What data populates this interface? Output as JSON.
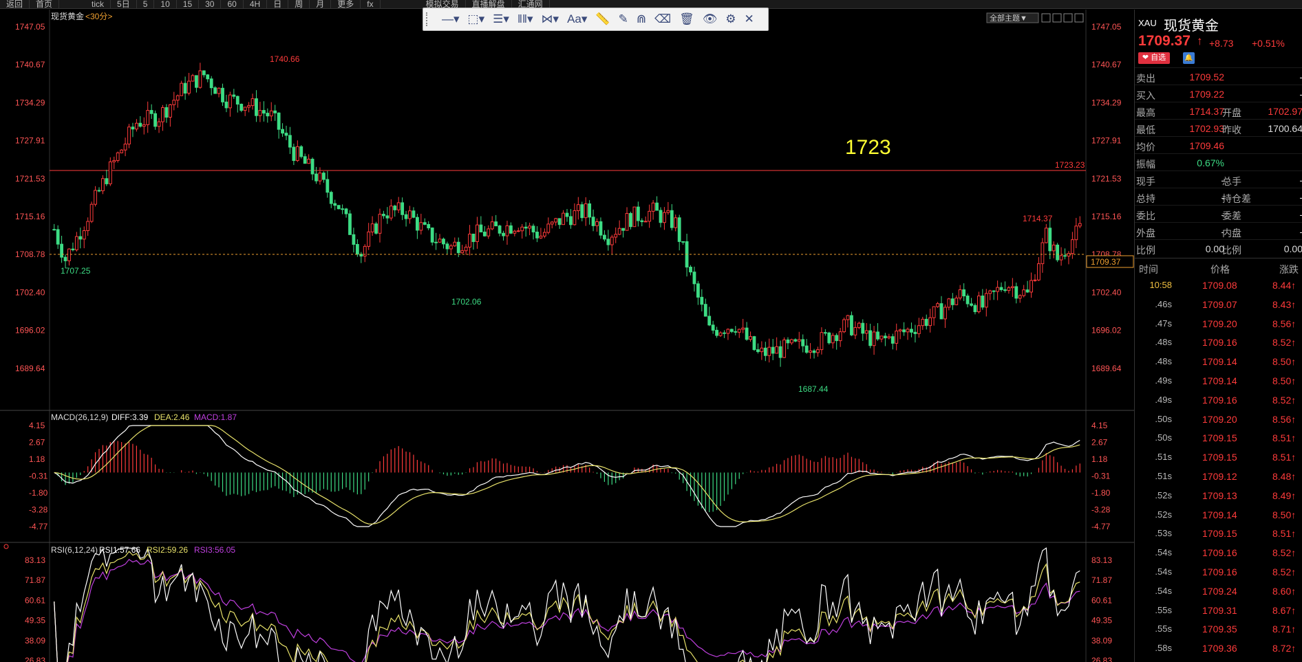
{
  "topbar": {
    "items": [
      "返回",
      "首页",
      "",
      "",
      "tick",
      "5日",
      "5",
      "10",
      "15",
      "30",
      "60",
      "4H",
      "日",
      "周",
      "月",
      "更多",
      "fx",
      "",
      "",
      "",
      "模拟交易",
      "直播解盘",
      "汇通网"
    ]
  },
  "chart": {
    "symbol_label": "现货黄金",
    "period_label": "<30分>",
    "theme_button": "全部主题▼",
    "annotation_text": "1723",
    "hline_label": "1723.23",
    "current_price_label": "1709.37",
    "price_ticks": [
      "1747.05",
      "1740.67",
      "1734.29",
      "1727.91",
      "1721.53",
      "1715.16",
      "1708.78",
      "1702.40",
      "1696.02",
      "1689.64"
    ],
    "marks": {
      "high": "1740.66",
      "low1": "1707.25",
      "low2": "1702.06",
      "low3": "1687.44",
      "high2": "1714.37"
    },
    "macd": {
      "label": "MACD(26,12,9)",
      "diff": "DIFF:3.39",
      "dea": "DEA:2.46",
      "macd": "MACD:1.87",
      "ticks": [
        "4.15",
        "2.67",
        "1.18",
        "-0.31",
        "-1.80",
        "-3.28",
        "-4.77"
      ]
    },
    "rsi": {
      "label": "RSI(6,12,24)",
      "rsi1": "RSI1:57.66",
      "rsi2": "RSI2:59.26",
      "rsi3": "RSI3:56.05",
      "ticks": [
        "83.13",
        "71.87",
        "60.61",
        "49.35",
        "38.09",
        "26.83"
      ]
    },
    "colors": {
      "up": "#ff3b3b",
      "down": "#3ddc84",
      "hline": "#ff3b3b",
      "annotation": "#ffff33",
      "diff": "#ffffff",
      "dea": "#e8e26a",
      "rsi1": "#ffffff",
      "rsi2": "#e8e26a",
      "rsi3": "#c040e0"
    }
  },
  "toolbar": {
    "tools": [
      {
        "icon": "line-tool-icon",
        "glyph": "—▾"
      },
      {
        "icon": "shape-tool-icon",
        "glyph": "⬚▾"
      },
      {
        "icon": "fib-tool-icon",
        "glyph": "☰▾"
      },
      {
        "icon": "channel-tool-icon",
        "glyph": "‖‖▾"
      },
      {
        "icon": "pattern-tool-icon",
        "glyph": "⋈▾"
      },
      {
        "icon": "text-tool-icon",
        "glyph": "Aa▾"
      },
      {
        "icon": "ruler-icon",
        "glyph": "📏"
      },
      {
        "icon": "pen-icon",
        "glyph": "✎"
      },
      {
        "icon": "magnet-icon",
        "glyph": "⋒"
      },
      {
        "icon": "eraser-icon",
        "glyph": "⌫"
      },
      {
        "icon": "trash-icon",
        "glyph": "🗑"
      },
      {
        "icon": "eye-icon",
        "glyph": "👁"
      },
      {
        "icon": "gear-icon",
        "glyph": "⚙"
      },
      {
        "icon": "close-icon",
        "glyph": "✕"
      }
    ]
  },
  "quote": {
    "code": "XAU",
    "name": "现货黄金",
    "price": "1709.37",
    "arrow": "↑",
    "change": "+8.73",
    "pct": "+0.51%",
    "fav_label": "❤ 自选",
    "bell_label": "🔔",
    "rows": [
      {
        "l": "卖出",
        "v": "1709.52",
        "l2": "",
        "v2": "-"
      },
      {
        "l": "买入",
        "v": "1709.22",
        "l2": "",
        "v2": "-"
      },
      {
        "l": "最高",
        "v": "1714.37",
        "l2": "开盘",
        "v2": "1702.97"
      },
      {
        "l": "最低",
        "v": "1702.93",
        "l2": "昨收",
        "v2": "1700.64"
      },
      {
        "l": "均价",
        "v": "1709.46",
        "l2": "",
        "v2": ""
      },
      {
        "l": "振幅",
        "v": "0.67%",
        "l2": "",
        "v2": ""
      },
      {
        "l": "现手",
        "v": "-",
        "l2": "总手",
        "v2": "-"
      },
      {
        "l": "总持",
        "v": "-",
        "l2": "持仓差",
        "v2": "-"
      },
      {
        "l": "委比",
        "v": "-",
        "l2": "委差",
        "v2": "-"
      },
      {
        "l": "外盘",
        "v": "-",
        "l2": "内盘",
        "v2": "-"
      },
      {
        "l": "比例",
        "v": "0.00",
        "l2": "比例",
        "v2": "0.00"
      }
    ]
  },
  "ticks": {
    "headers": [
      "时间",
      "价格",
      "涨跌"
    ],
    "rows": [
      {
        "t": "10:58",
        "p": "1709.08",
        "d": "8.44↑"
      },
      {
        "t": ".46s",
        "p": "1709.07",
        "d": "8.43↑"
      },
      {
        "t": ".47s",
        "p": "1709.20",
        "d": "8.56↑"
      },
      {
        "t": ".48s",
        "p": "1709.16",
        "d": "8.52↑"
      },
      {
        "t": ".48s",
        "p": "1709.14",
        "d": "8.50↑"
      },
      {
        "t": ".49s",
        "p": "1709.14",
        "d": "8.50↑"
      },
      {
        "t": ".49s",
        "p": "1709.16",
        "d": "8.52↑"
      },
      {
        "t": ".50s",
        "p": "1709.20",
        "d": "8.56↑"
      },
      {
        "t": ".50s",
        "p": "1709.15",
        "d": "8.51↑"
      },
      {
        "t": ".51s",
        "p": "1709.15",
        "d": "8.51↑"
      },
      {
        "t": ".51s",
        "p": "1709.12",
        "d": "8.48↑"
      },
      {
        "t": ".52s",
        "p": "1709.13",
        "d": "8.49↑"
      },
      {
        "t": ".52s",
        "p": "1709.14",
        "d": "8.50↑"
      },
      {
        "t": ".53s",
        "p": "1709.15",
        "d": "8.51↑"
      },
      {
        "t": ".54s",
        "p": "1709.16",
        "d": "8.52↑"
      },
      {
        "t": ".54s",
        "p": "1709.16",
        "d": "8.52↑"
      },
      {
        "t": ".54s",
        "p": "1709.24",
        "d": "8.60↑"
      },
      {
        "t": ".55s",
        "p": "1709.31",
        "d": "8.67↑"
      },
      {
        "t": ".55s",
        "p": "1709.35",
        "d": "8.71↑"
      },
      {
        "t": ".58s",
        "p": "1709.36",
        "d": "8.72↑"
      }
    ]
  },
  "chart_data": {
    "type": "candlestick",
    "hline": 1723.23,
    "price_range": [
      1685,
      1749
    ],
    "trend_anchors": [
      [
        0,
        1713
      ],
      [
        3,
        1708
      ],
      [
        8,
        1714
      ],
      [
        14,
        1722
      ],
      [
        22,
        1731
      ],
      [
        28,
        1732
      ],
      [
        35,
        1737
      ],
      [
        40,
        1739
      ],
      [
        46,
        1735
      ],
      [
        52,
        1734
      ],
      [
        58,
        1732
      ],
      [
        64,
        1726
      ],
      [
        70,
        1722
      ],
      [
        76,
        1717
      ],
      [
        82,
        1709
      ],
      [
        88,
        1716
      ],
      [
        94,
        1716
      ],
      [
        100,
        1712
      ],
      [
        106,
        1710
      ],
      [
        112,
        1712
      ],
      [
        118,
        1713
      ],
      [
        124,
        1714
      ],
      [
        130,
        1712
      ],
      [
        136,
        1715
      ],
      [
        142,
        1716
      ],
      [
        148,
        1712
      ],
      [
        154,
        1715
      ],
      [
        160,
        1716
      ],
      [
        166,
        1714
      ],
      [
        170,
        1705
      ],
      [
        175,
        1696
      ],
      [
        182,
        1697
      ],
      [
        188,
        1692
      ],
      [
        196,
        1693
      ],
      [
        204,
        1694
      ],
      [
        212,
        1697
      ],
      [
        220,
        1694
      ],
      [
        228,
        1696
      ],
      [
        236,
        1699
      ],
      [
        242,
        1702
      ],
      [
        248,
        1700
      ],
      [
        254,
        1704
      ],
      [
        260,
        1702
      ],
      [
        265,
        1712
      ],
      [
        268,
        1708
      ],
      [
        274,
        1713
      ]
    ],
    "candle_count": 275
  }
}
